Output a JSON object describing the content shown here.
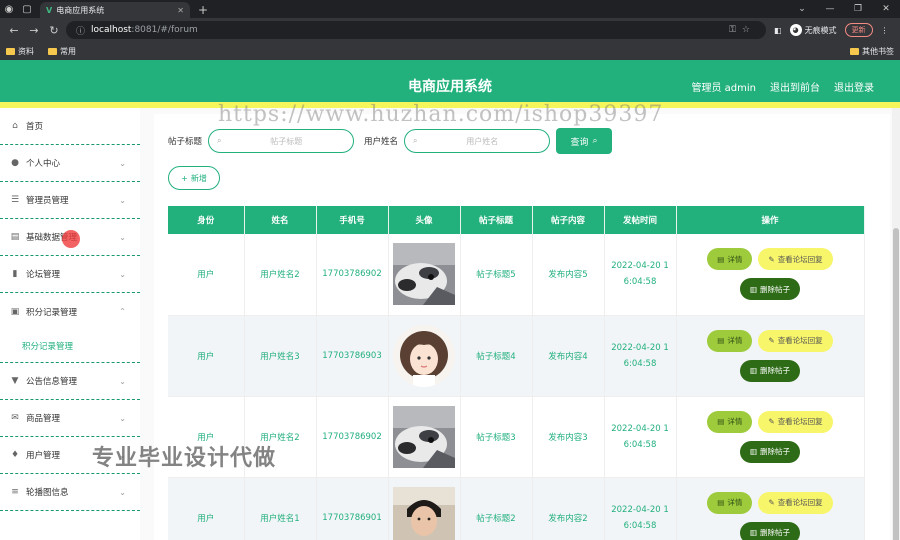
{
  "browser": {
    "tab_title": "电商应用系统",
    "url_host": "localhost",
    "url_rest": ":8081/#/forum",
    "incognito": "无痕模式",
    "update": "更新",
    "bookmarks": [
      "资料",
      "常用"
    ],
    "other_bookmarks": "其他书签"
  },
  "header": {
    "title": "电商应用系统",
    "admin": "管理员 admin",
    "back_front": "退出到前台",
    "logout": "退出登录"
  },
  "sidebar": {
    "items": [
      {
        "label": "首页",
        "icon": "home-icon"
      },
      {
        "label": "个人中心",
        "icon": "user-icon"
      },
      {
        "label": "管理员管理",
        "icon": "sliders-icon"
      },
      {
        "label": "基础数据管理",
        "icon": "folder-icon"
      },
      {
        "label": "论坛管理",
        "icon": "chart-icon"
      },
      {
        "label": "积分记录管理",
        "icon": "clipboard-icon"
      },
      {
        "label": "公告信息管理",
        "icon": "megaphone-icon"
      },
      {
        "label": "商品管理",
        "icon": "mail-icon"
      },
      {
        "label": "用户管理",
        "icon": "mic-icon"
      },
      {
        "label": "轮播图信息",
        "icon": "list-icon"
      }
    ],
    "sub_item": "积分记录管理"
  },
  "search": {
    "title_label": "帖子标题",
    "title_placeholder": "帖子标题",
    "user_label": "用户姓名",
    "user_placeholder": "用户姓名",
    "search_btn": "查询"
  },
  "add_btn": "新增",
  "table": {
    "headers": [
      "身份",
      "姓名",
      "手机号",
      "头像",
      "帖子标题",
      "帖子内容",
      "发帖时间",
      "操作"
    ],
    "rows": [
      {
        "role": "用户",
        "name": "用户姓名2",
        "phone": "17703786902",
        "title": "帖子标题5",
        "content": "发布内容5",
        "time1": "2022-04-20 1",
        "time2": "6:04:58"
      },
      {
        "role": "用户",
        "name": "用户姓名3",
        "phone": "17703786903",
        "title": "帖子标题4",
        "content": "发布内容4",
        "time1": "2022-04-20 1",
        "time2": "6:04:58"
      },
      {
        "role": "用户",
        "name": "用户姓名2",
        "phone": "17703786902",
        "title": "帖子标题3",
        "content": "发布内容3",
        "time1": "2022-04-20 1",
        "time2": "6:04:58"
      },
      {
        "role": "用户",
        "name": "用户姓名1",
        "phone": "17703786901",
        "title": "帖子标题2",
        "content": "发布内容2",
        "time1": "2022-04-20 1",
        "time2": "6:04:58"
      }
    ],
    "ops": {
      "detail": "详情",
      "reply": "查看论坛回复",
      "delete": "删除帖子"
    }
  },
  "watermarks": {
    "url": "https://www.huzhan.com/ishop39397",
    "cn": "专业毕业设计代做"
  }
}
